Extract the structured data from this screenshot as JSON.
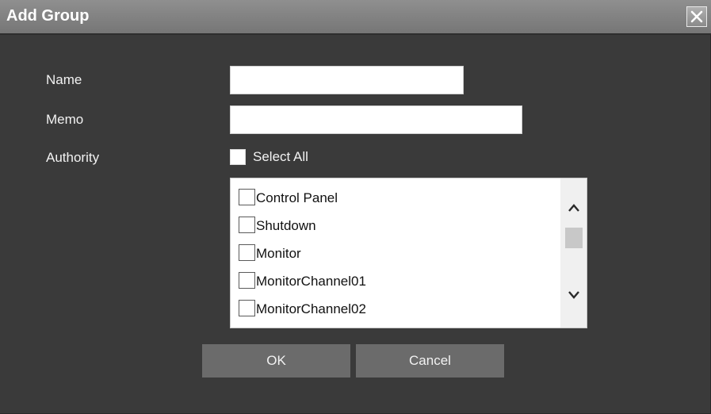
{
  "dialog": {
    "title": "Add Group",
    "close_icon": "close-icon"
  },
  "form": {
    "name_label": "Name",
    "name_value": "",
    "memo_label": "Memo",
    "memo_value": "",
    "authority_label": "Authority",
    "select_all_label": "Select All",
    "select_all_checked": false
  },
  "authority_list": {
    "items": [
      {
        "label": "Control Panel",
        "checked": false
      },
      {
        "label": "Shutdown",
        "checked": false
      },
      {
        "label": "Monitor",
        "checked": false
      },
      {
        "label": "MonitorChannel01",
        "checked": false
      },
      {
        "label": "MonitorChannel02",
        "checked": false
      }
    ],
    "scroll_up_icon": "chevron-up-icon",
    "scroll_down_icon": "chevron-down-icon"
  },
  "buttons": {
    "ok_label": "OK",
    "cancel_label": "Cancel"
  },
  "colors": {
    "background": "#3a3a3a",
    "titlebar": "#808080",
    "button": "#6b6b6b",
    "text": "#f2f2f2"
  }
}
